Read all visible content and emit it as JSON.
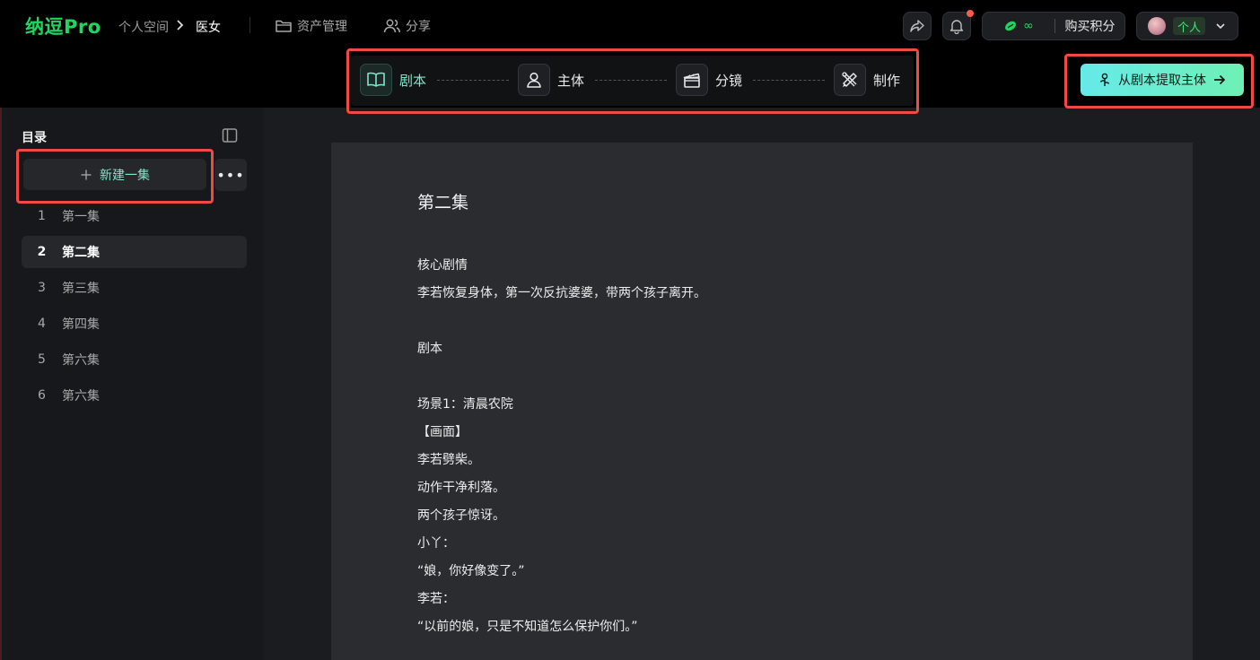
{
  "header": {
    "logo": "纳逗Pro",
    "breadcrumb": [
      "个人空间",
      "医女"
    ],
    "nav": [
      {
        "label": "资产管理",
        "icon": "folder-icon"
      },
      {
        "label": "分享",
        "icon": "users-icon"
      }
    ],
    "credits": {
      "value": "∞",
      "buy_label": "购买积分"
    },
    "user": {
      "tag": "个人"
    }
  },
  "steps": [
    {
      "label": "剧本",
      "icon": "book-open-icon",
      "active": true
    },
    {
      "label": "主体",
      "icon": "person-icon",
      "active": false
    },
    {
      "label": "分镜",
      "icon": "clapperboard-icon",
      "active": false
    },
    {
      "label": "制作",
      "icon": "tools-icon",
      "active": false
    }
  ],
  "extract_button": {
    "label": "从剧本提取主体"
  },
  "sidebar": {
    "title": "目录",
    "new_episode_label": "新建一集",
    "episodes": [
      {
        "num": "1",
        "name": "第一集"
      },
      {
        "num": "2",
        "name": "第二集",
        "active": true
      },
      {
        "num": "3",
        "name": "第三集"
      },
      {
        "num": "4",
        "name": "第四集"
      },
      {
        "num": "5",
        "name": "第六集"
      },
      {
        "num": "6",
        "name": "第六集"
      }
    ]
  },
  "document": {
    "title": "第二集",
    "lines": [
      "核心剧情",
      "李若恢复身体，第一次反抗婆婆，带两个孩子离开。",
      "",
      "剧本",
      "",
      "场景1：清晨农院",
      "【画面】",
      "李若劈柴。",
      "动作干净利落。",
      "两个孩子惊讶。",
      "小丫：",
      "“娘，你好像变了。”",
      "李若：",
      "“以前的娘，只是不知道怎么保护你们。”"
    ]
  },
  "colors": {
    "accent_green": "#1ed760",
    "accent_teal": "#7fe6cc",
    "highlight_red": "#ef4a44",
    "notification_dot": "#ff5a4e"
  }
}
